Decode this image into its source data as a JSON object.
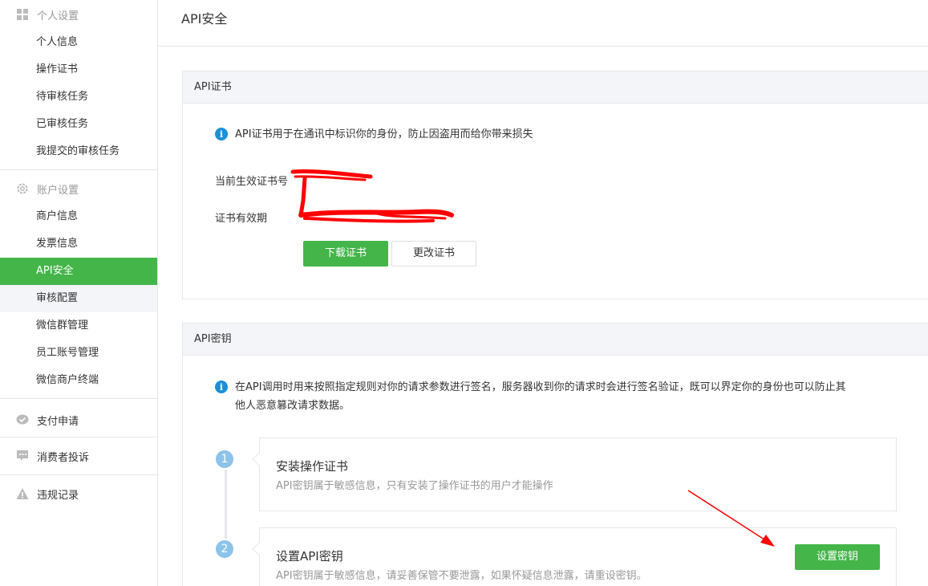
{
  "sidebar": {
    "groups": [
      {
        "title": "个人设置",
        "icon": "grid-icon",
        "items": [
          "个人信息",
          "操作证书",
          "待审核任务",
          "已审核任务",
          "我提交的审核任务"
        ]
      },
      {
        "title": "账户设置",
        "icon": "gear-icon",
        "items": [
          "商户信息",
          "发票信息",
          "API安全",
          "审核配置",
          "微信群管理",
          "员工账号管理",
          "微信商户终端"
        ]
      },
      {
        "title": "支付申请",
        "icon": "check-bubble-icon"
      },
      {
        "title": "消费者投诉",
        "icon": "chat-bubble-icon"
      },
      {
        "title": "违规记录",
        "icon": "warning-icon"
      }
    ],
    "active_item": "API安全"
  },
  "page": {
    "title": "API安全"
  },
  "cert_panel": {
    "title": "API证书",
    "info": "API证书用于在通讯中标识你的身份，防止因盗用而给你带来损失",
    "current_cert_label": "当前生效证书号",
    "validity_label": "证书有效期",
    "download_button": "下载证书",
    "change_button": "更改证书"
  },
  "key_panel": {
    "title": "API密钥",
    "info_line1": "在API调用时用来按照指定规则对你的请求参数进行签名，服务器收到你的请求时会进行签名验证，既可以界定你的身份也可以防止其",
    "info_line2": "他人恶意篡改请求数据。",
    "steps": [
      {
        "num": "1",
        "title": "安装操作证书",
        "desc": "API密钥属于敏感信息，只有安装了操作证书的用户才能操作"
      },
      {
        "num": "2",
        "title": "设置API密钥",
        "desc": "API密钥属于敏感信息，请妥善保管不要泄露，如果怀疑信息泄露，请重设密钥。"
      }
    ],
    "set_key_button": "设置密钥"
  },
  "colors": {
    "accent": "#44b549",
    "info": "#1a90d9",
    "step": "#8dc3ea",
    "annotation": "#ff0000"
  }
}
